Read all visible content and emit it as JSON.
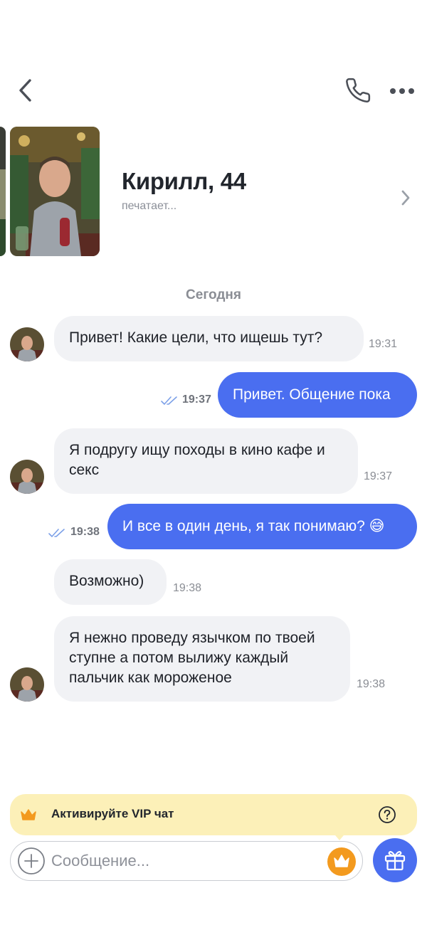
{
  "header": {
    "back_icon": "chevron-left-icon",
    "call_icon": "phone-icon",
    "more_icon": "more-horizontal-icon"
  },
  "profile": {
    "name": "Кирилл, 44",
    "status": "печатает..."
  },
  "chat": {
    "date_label": "Сегодня",
    "messages": [
      {
        "from": "them",
        "text": "Привет! Какие цели, что ищешь тут?",
        "time": "19:31"
      },
      {
        "from": "me",
        "text": "Привет. Общение пока",
        "time": "19:37"
      },
      {
        "from": "them",
        "line1": "Я подругу ищу походы в кино кафе и",
        "line2": "секс",
        "time": "19:37"
      },
      {
        "from": "me",
        "text": "И все в один день, я так понимаю? 😅",
        "time": "19:38"
      },
      {
        "from": "them",
        "text": "Возможно)",
        "time": "19:38"
      },
      {
        "from": "them",
        "line1": "Я нежно проведу язычком по твоей",
        "line2": "ступне а потом вылижу каждый",
        "line3": "пальчик как мороженое",
        "time": "19:38"
      }
    ]
  },
  "vip": {
    "label": "Активируйте VIP чат",
    "icon": "crown-icon",
    "help_icon": "question-circle-icon"
  },
  "composer": {
    "placeholder": "Сообщение...",
    "add_icon": "plus-circle-icon",
    "crown_icon": "crown-icon",
    "gift_icon": "gift-icon"
  },
  "colors": {
    "accent": "#4a6ef0",
    "incoming_bubble": "#f1f2f5",
    "vip_banner": "#fcf0b8",
    "crown": "#f39a1e"
  }
}
